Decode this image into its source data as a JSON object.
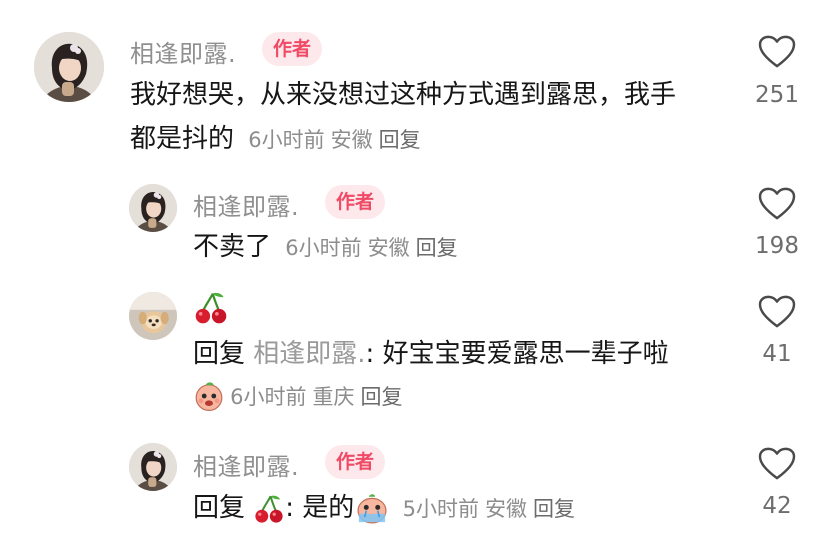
{
  "comments": [
    {
      "username": "相逢即露.",
      "badge": "作者",
      "text_line1": "我好想哭，从来没想过这种方式遇到露思，我手",
      "text_line2": "都是抖的",
      "time": "6小时前",
      "location": "安徽",
      "reply_label": "回复",
      "likes": "251"
    },
    {
      "username": "相逢即露.",
      "badge": "作者",
      "text": "不卖了",
      "time": "6小时前",
      "location": "安徽",
      "reply_label": "回复",
      "likes": "198"
    },
    {
      "username_emoji": "cherries-emoji",
      "reply_prefix": "回复",
      "reply_to": "相逢即露.",
      "text": ": 好宝宝要爱露思一辈子啦",
      "time": "6小时前",
      "location": "重庆",
      "reply_label": "回复",
      "likes": "41"
    },
    {
      "username": "相逢即露.",
      "badge": "作者",
      "reply_prefix": "回复",
      "text": ": 是的",
      "time": "5小时前",
      "location": "安徽",
      "reply_label": "回复",
      "likes": "42"
    }
  ],
  "icons": {
    "like": "heart-outline-icon"
  },
  "colors": {
    "badge_bg": "#fde9ec",
    "badge_text": "#f04a66",
    "username": "#8f8f8f",
    "meta": "#8d8d8d"
  }
}
